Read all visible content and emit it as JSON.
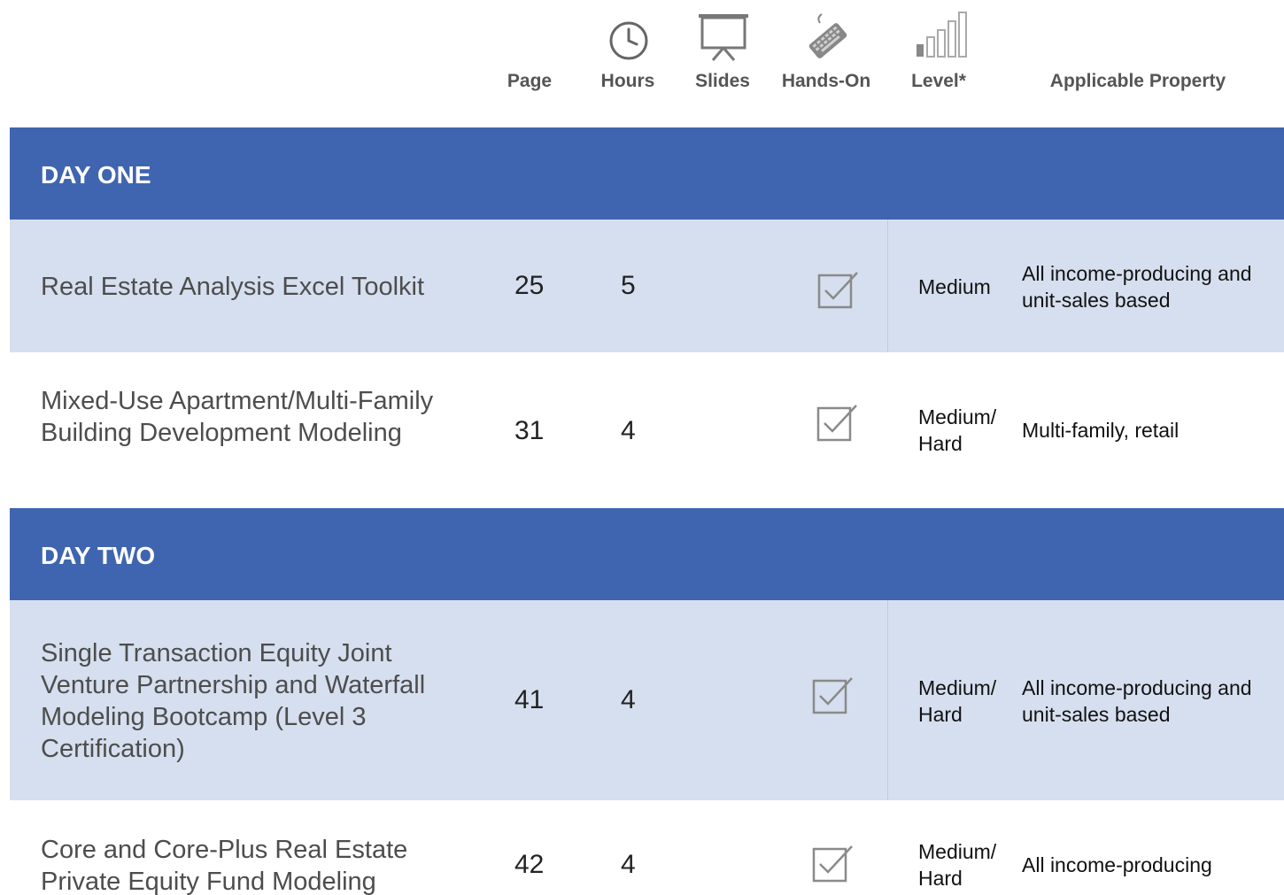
{
  "header": {
    "page_label": "Page",
    "hours_label": "Hours",
    "slides_label": "Slides",
    "handson_label": "Hands-On",
    "level_label": "Level*",
    "property_label": "Applicable Property",
    "icons": [
      "clock-icon",
      "presentation-screen-icon",
      "keyboard-icon",
      "signal-bars-icon"
    ]
  },
  "day_one": {
    "title": "DAY ONE",
    "rows": [
      {
        "title": "Real Estate Analysis Excel Toolkit",
        "page": "25",
        "hours": "5",
        "hands_on": true,
        "level": "Medium",
        "property": "All income-producing and unit-sales based"
      },
      {
        "title": "Mixed-Use Apartment/Multi-Family Building Development Modeling",
        "page": "31",
        "hours": "4",
        "hands_on": true,
        "level": "Medium/ Hard",
        "property": "Multi-family, retail"
      }
    ]
  },
  "day_two": {
    "title": "DAY TWO",
    "rows": [
      {
        "title": "Single Transaction Equity Joint Venture Partnership and Waterfall Modeling Bootcamp (Level 3 Certification)",
        "page": "41",
        "hours": "4",
        "hands_on": true,
        "level": "Medium/ Hard",
        "property": "All income-producing and unit-sales based"
      },
      {
        "title": "Core and Core-Plus Real Estate Private Equity Fund Modeling",
        "page": "42",
        "hours": "4",
        "hands_on": true,
        "level": "Medium/ Hard",
        "property": "All income-producing"
      }
    ]
  },
  "colors": {
    "band": "#3f65b0",
    "shaded_row": "#d6dfef",
    "icon_gray": "#8a8a8a"
  }
}
